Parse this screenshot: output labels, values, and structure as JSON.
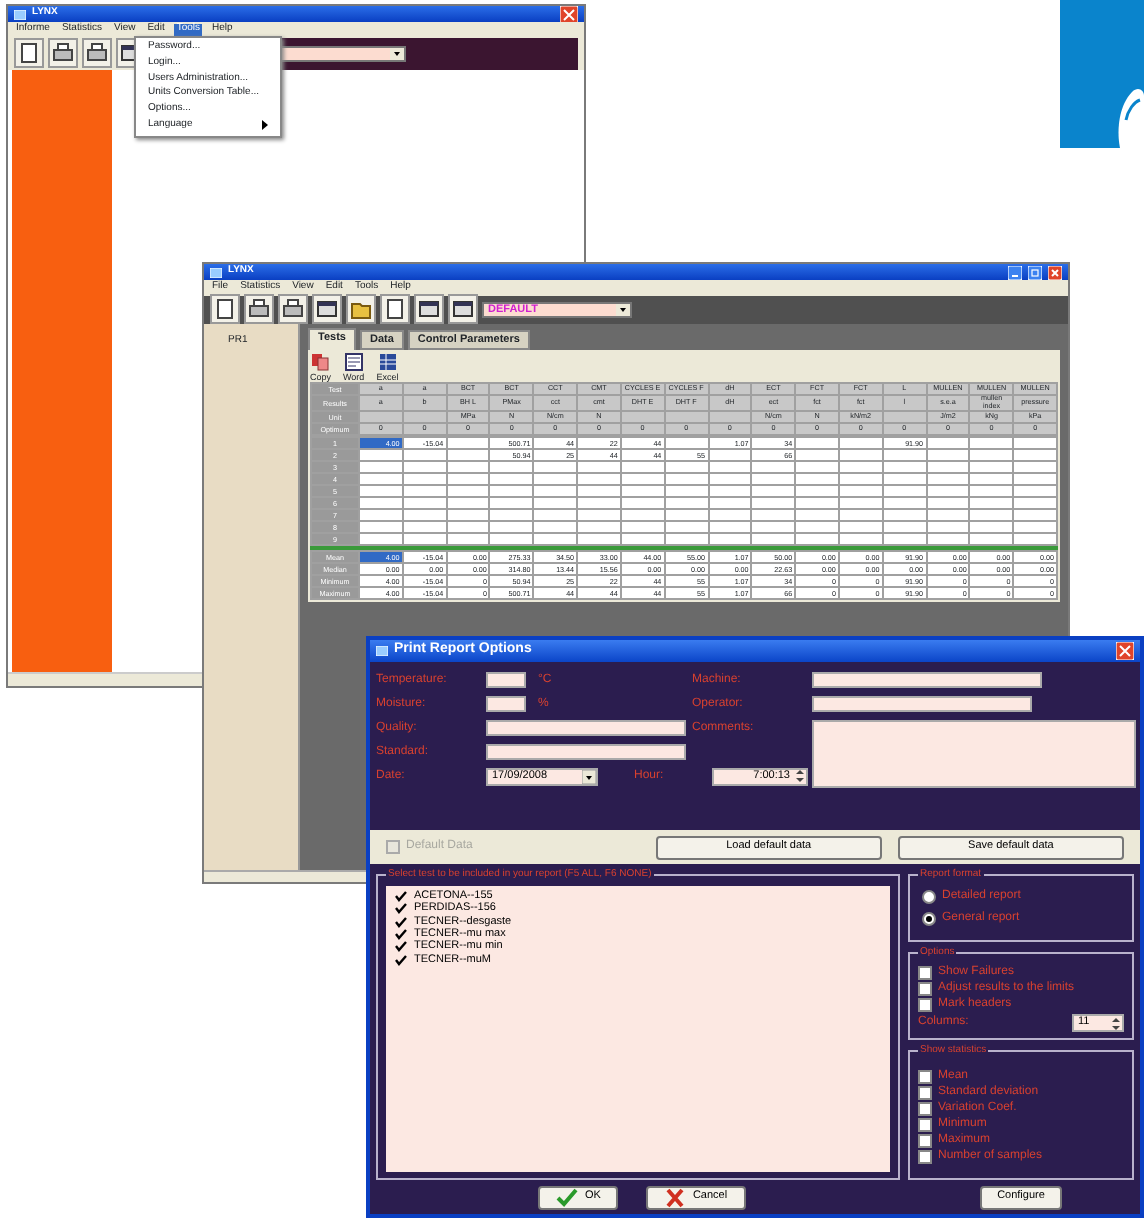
{
  "back_window": {
    "title": "LYNX",
    "menu": [
      {
        "label": "Informe",
        "selected": false
      },
      {
        "label": "Statistics",
        "selected": false
      },
      {
        "label": "View",
        "selected": false
      },
      {
        "label": "Edit",
        "selected": false
      },
      {
        "label": "Tools",
        "selected": true
      },
      {
        "label": "Help",
        "selected": false
      }
    ],
    "open_menu": [
      {
        "label": "Password...",
        "submenu": false
      },
      {
        "label": "Login...",
        "submenu": false
      },
      {
        "label": "Users Administration...",
        "submenu": false
      },
      {
        "label": "Units Conversion Table...",
        "submenu": false
      },
      {
        "label": "Options...",
        "submenu": false
      },
      {
        "label": "Language",
        "submenu": true
      }
    ]
  },
  "middle_window": {
    "title": "LYNX",
    "menu": [
      "File",
      "Statistics",
      "View",
      "Edit",
      "Tools",
      "Help"
    ],
    "combo": "DEFAULT",
    "tree": [
      "PR1"
    ],
    "tabs": [
      {
        "label": "Tests",
        "selected": true
      },
      {
        "label": "Data",
        "selected": false
      },
      {
        "label": "Control Parameters",
        "selected": false
      }
    ],
    "tools": [
      {
        "label": "Copy",
        "kind": "copy"
      },
      {
        "label": "Word",
        "kind": "word"
      },
      {
        "label": "Excel",
        "kind": "excel"
      }
    ],
    "table": {
      "header_rows": [
        {
          "label": "Test",
          "cells": [
            "a",
            "a",
            "BCT",
            "BCT",
            "CCT",
            "CMT",
            "CYCLES E",
            "CYCLES F",
            "dH",
            "ECT",
            "FCT",
            "FCT",
            "L",
            "MULLEN",
            "MULLEN",
            "MULLEN"
          ]
        },
        {
          "label": "Results",
          "cells": [
            "a",
            "b",
            "BH L",
            "PMax",
            "cct",
            "cmt",
            "DHT E",
            "DHT F",
            "dH",
            "ect",
            "fct",
            "fct",
            "l",
            "s.e.a",
            "mullen index",
            "pressure"
          ]
        },
        {
          "label": "Unit",
          "cells": [
            null,
            null,
            "MPa",
            "N",
            "N/cm",
            "N",
            null,
            null,
            null,
            "N/cm",
            "N",
            "kN/m2",
            null,
            "J/m2",
            "kNg",
            "kPa"
          ]
        },
        {
          "label": "Optimum",
          "cells": [
            "0",
            "0",
            "0",
            "0",
            "0",
            "0",
            "0",
            "0",
            "0",
            "0",
            "0",
            "0",
            "0",
            "0",
            "0",
            "0"
          ]
        }
      ],
      "rows": [
        {
          "label": "1",
          "cells": [
            "4.00",
            "-15.04",
            null,
            "500.71",
            "44",
            "22",
            "44",
            null,
            "1.07",
            "34",
            null,
            null,
            "91.90",
            null,
            null,
            null
          ]
        },
        {
          "label": "2",
          "cells": [
            null,
            null,
            null,
            "50.94",
            "25",
            "44",
            "44",
            "55",
            null,
            "66",
            null,
            null,
            null,
            null,
            null,
            null
          ]
        },
        {
          "label": "3"
        },
        {
          "label": "4"
        },
        {
          "label": "5"
        },
        {
          "label": "6"
        },
        {
          "label": "7"
        },
        {
          "label": "8"
        },
        {
          "label": "9"
        }
      ],
      "stat_rows": [
        {
          "label": "Mean",
          "cells": [
            "4.00",
            "-15.04",
            "0.00",
            "275.33",
            "34.50",
            "33.00",
            "44.00",
            "55.00",
            "1.07",
            "50.00",
            "0.00",
            "0.00",
            "91.90",
            "0.00",
            "0.00",
            "0.00"
          ]
        },
        {
          "label": "Median",
          "cells": [
            "0.00",
            "0.00",
            "0.00",
            "314.80",
            "13.44",
            "15.56",
            "0.00",
            "0.00",
            "0.00",
            "22.63",
            "0.00",
            "0.00",
            "0.00",
            "0.00",
            "0.00",
            "0.00"
          ]
        },
        {
          "label": "Minimum",
          "cells": [
            "4.00",
            "-15.04",
            "0",
            "50.94",
            "25",
            "22",
            "44",
            "55",
            "1.07",
            "34",
            "0",
            "0",
            "91.90",
            "0",
            "0",
            "0"
          ]
        },
        {
          "label": "Maximum",
          "cells": [
            "4.00",
            "-15.04",
            "0",
            "500.71",
            "44",
            "44",
            "44",
            "55",
            "1.07",
            "66",
            "0",
            "0",
            "91.90",
            "0",
            "0",
            "0"
          ]
        }
      ]
    }
  },
  "dialog": {
    "title": "Print Report Options",
    "left_fields": [
      {
        "label": "Temperature:",
        "unit": "°C"
      },
      {
        "label": "Moisture:",
        "unit": "%"
      },
      {
        "label": "Quality:"
      },
      {
        "label": "Standard:"
      }
    ],
    "date": {
      "label": "Date:",
      "value": "17/09/2008"
    },
    "hour": {
      "label": "Hour:",
      "value": "7:00:13"
    },
    "right_fields": [
      {
        "label": "Machine:"
      },
      {
        "label": "Operator:"
      },
      {
        "label": "Comments:"
      }
    ],
    "default_data": {
      "label": "Default Data",
      "checked": false,
      "disabled": true
    },
    "strip_buttons": [
      "Load default data",
      "Save default data"
    ],
    "tests": {
      "title": "Select test to be included in your report (F5 ALL, F6 NONE)",
      "items": [
        {
          "label": "ACETONA--155",
          "checked": true
        },
        {
          "label": "PERDIDAS--156",
          "checked": true
        },
        {
          "label": "TECNER--desgaste",
          "checked": true
        },
        {
          "label": "TECNER--mu max",
          "checked": true
        },
        {
          "label": "TECNER--mu min",
          "checked": true
        },
        {
          "label": "TECNER--muM",
          "checked": true
        }
      ]
    },
    "report_format": {
      "title": "Report format",
      "options": [
        {
          "label": "Detailed report",
          "selected": false
        },
        {
          "label": "General report",
          "selected": true
        }
      ]
    },
    "options": {
      "title": "Options",
      "items": [
        {
          "label": "Show Failures",
          "checked": false
        },
        {
          "label": "Adjust results to the limits",
          "checked": false
        },
        {
          "label": "Mark headers",
          "checked": false
        }
      ],
      "columns_label": "Columns:",
      "columns_value": "11"
    },
    "statistics": {
      "title": "Show statistics",
      "items": [
        {
          "label": "Mean",
          "checked": false
        },
        {
          "label": "Standard deviation",
          "checked": false
        },
        {
          "label": "Variation Coef.",
          "checked": false
        },
        {
          "label": "Minimum",
          "checked": false
        },
        {
          "label": "Maximum",
          "checked": false
        },
        {
          "label": "Number of samples",
          "checked": false
        }
      ]
    },
    "buttons": [
      {
        "label": "OK",
        "kind": "ok"
      },
      {
        "label": "Cancel",
        "kind": "cancel"
      },
      {
        "label": "Configure",
        "kind": "plain"
      }
    ]
  }
}
